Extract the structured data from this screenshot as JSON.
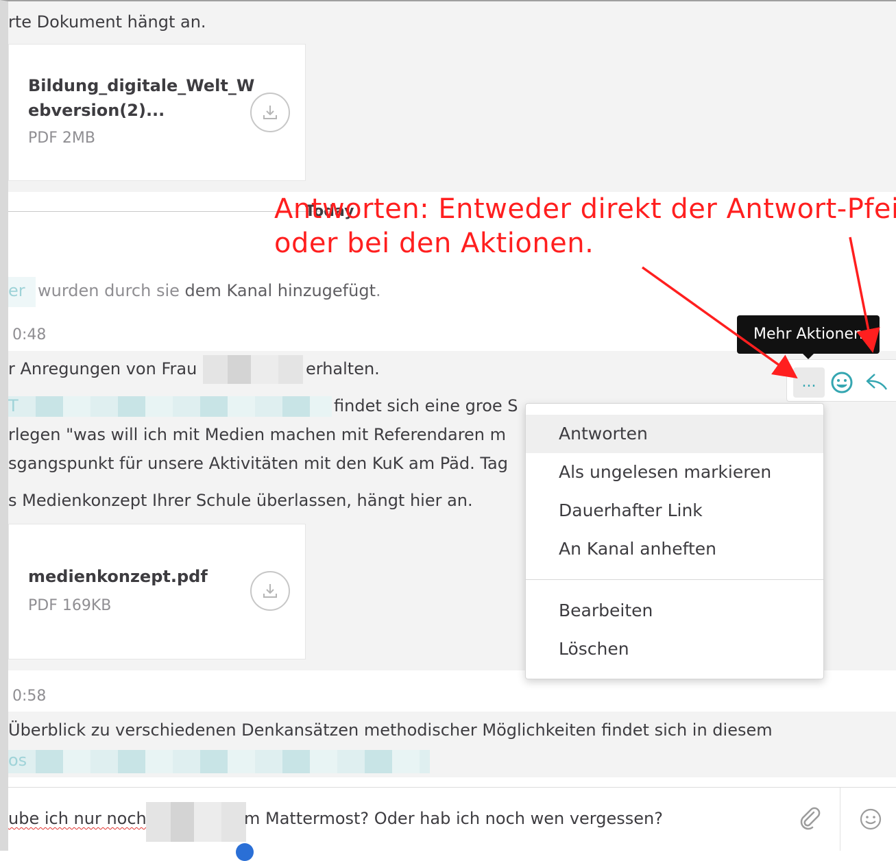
{
  "messages": {
    "top_text": "rte Dokument hängt an.",
    "file1": {
      "name_line1": "Bildung_digitale_Welt_W",
      "name_line2": "ebversion(2)...",
      "meta": "PDF 2MB"
    },
    "date_separator": "Today",
    "system_prefix": "er",
    "system_text_normal": "wurden durch sie",
    "system_text_bold": "dem Kanal hinzugefügt",
    "system_text_end": ".",
    "time1": "0:48",
    "msg1_line1_a": "r Anregungen von Frau",
    "msg1_line1_b": "erhalten.",
    "msg1_line2_prefix": "T",
    "msg1_line2": "findet sich eine groe S",
    "msg1_line3": "rlegen \"was will ich mit Medien machen mit Referendaren m",
    "msg1_line4": "sgangspunkt für unsere Aktivitäten mit den KuK am Päd. Tag",
    "msg1_line5": "s Medienkonzept Ihrer Schule überlassen, hängt hier an.",
    "file2": {
      "name": "medienkonzept.pdf",
      "meta": "PDF 169KB"
    },
    "time2": "0:58",
    "msg2_line1": "Überblick zu verschiedenen Denkansätzen methodischer Möglichkeiten findet sich in diesem",
    "msg2_line2_prefix": "os"
  },
  "actions": {
    "more_label": "...",
    "tooltip": "Mehr Aktionen",
    "emoji_icon": "smiley-icon",
    "reply_icon": "reply-arrow-icon"
  },
  "menu": {
    "group1": [
      "Antworten",
      "Als ungelesen markieren",
      "Dauerhafter Link",
      "An Kanal anheften"
    ],
    "group2": [
      "Bearbeiten",
      "Löschen"
    ]
  },
  "composer": {
    "text_a": "ube ich nur noch",
    "text_b": "m Mattermost? Oder hab ich noch wen vergessen?",
    "attach_icon": "paperclip-icon",
    "emoji_icon": "smiley-icon"
  },
  "annotation": {
    "line1": "Antworten: Entweder direkt der Antwort-Pfeil",
    "line2": "oder bei den Aktionen.",
    "color": "#ff1f1f"
  }
}
